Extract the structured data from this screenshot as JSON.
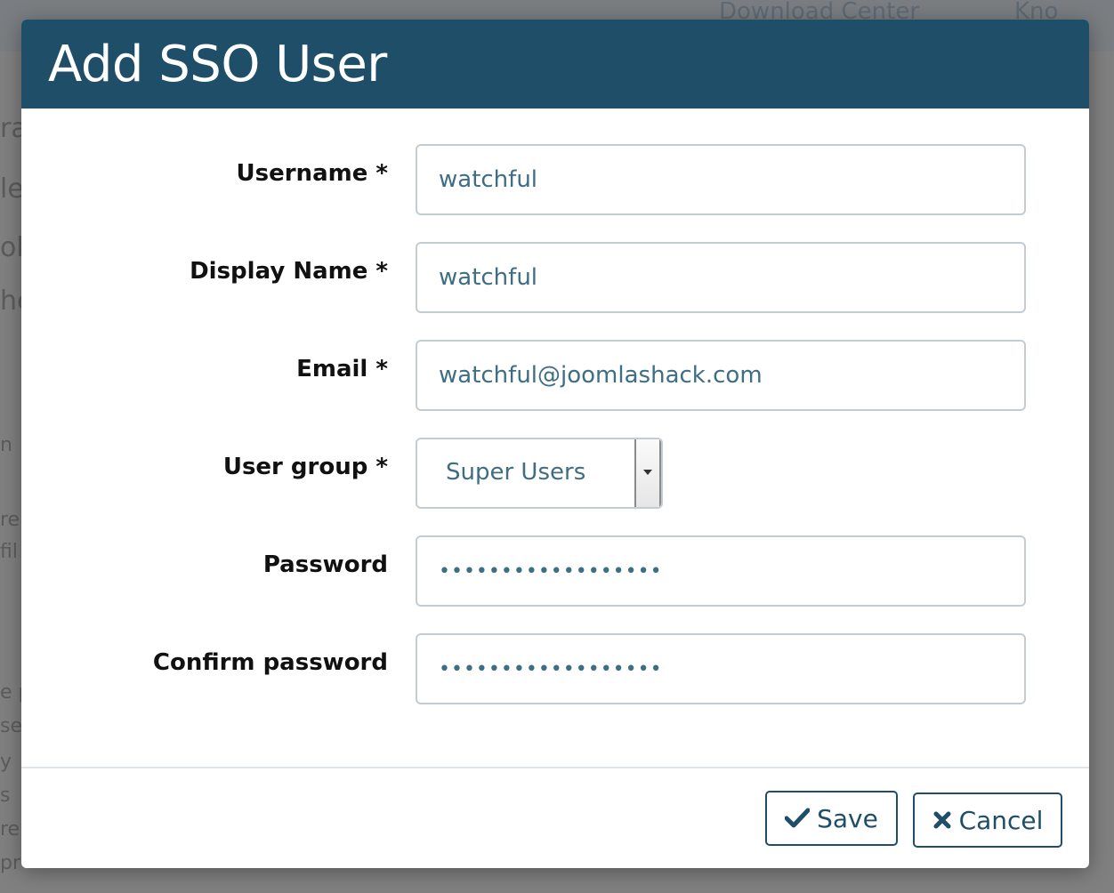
{
  "background": {
    "topbar_links": [
      "Download Center",
      "Kno"
    ],
    "fragments": [
      "ra",
      "le",
      "ol",
      "he",
      "n",
      "re",
      "fil",
      "e p",
      "se",
      "y",
      "s",
      "re",
      "pr"
    ]
  },
  "modal": {
    "title": "Add SSO User",
    "fields": {
      "username": {
        "label": "Username *",
        "value": "watchful"
      },
      "display_name": {
        "label": "Display Name *",
        "value": "watchful"
      },
      "email": {
        "label": "Email *",
        "value": "watchful@joomlashack.com"
      },
      "user_group": {
        "label": "User group *",
        "selected": "Super Users"
      },
      "password": {
        "label": "Password",
        "value": "••••••••••••••••••"
      },
      "confirm_password": {
        "label": "Confirm password",
        "value": "••••••••••••••••••"
      }
    },
    "footer": {
      "save_label": "Save",
      "cancel_label": "Cancel"
    }
  },
  "colors": {
    "header_bg": "#1e4e68",
    "input_text": "#3e6e84",
    "button_border": "#1e4e68"
  },
  "icons": {
    "save": "check-icon",
    "cancel": "close-icon",
    "select": "caret-down-icon"
  }
}
